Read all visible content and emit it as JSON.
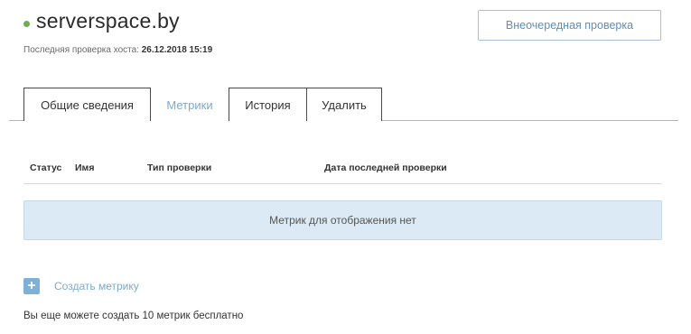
{
  "host": {
    "name": "serverspace.by",
    "status_color": "#6ab04c",
    "last_check_label": "Последняя проверка хоста:",
    "last_check_value": "26.12.2018 15:19"
  },
  "actions": {
    "extra_check_label": "Внеочередная проверка"
  },
  "tabs": [
    {
      "label": "Общие сведения",
      "active": false
    },
    {
      "label": "Метрики",
      "active": true
    },
    {
      "label": "История",
      "active": false
    },
    {
      "label": "Удалить",
      "active": false
    }
  ],
  "table": {
    "columns": [
      "Статус",
      "Имя",
      "Тип проверки",
      "Дата последней проверки"
    ],
    "empty_message": "Метрик для отображения нет"
  },
  "create": {
    "icon": "plus-icon",
    "label": "Создать метрику",
    "note": "Вы еще можете создать 10 метрик бесплатно"
  },
  "colors": {
    "accent": "#7fa9c9",
    "empty_bg": "#dbeaf4"
  }
}
